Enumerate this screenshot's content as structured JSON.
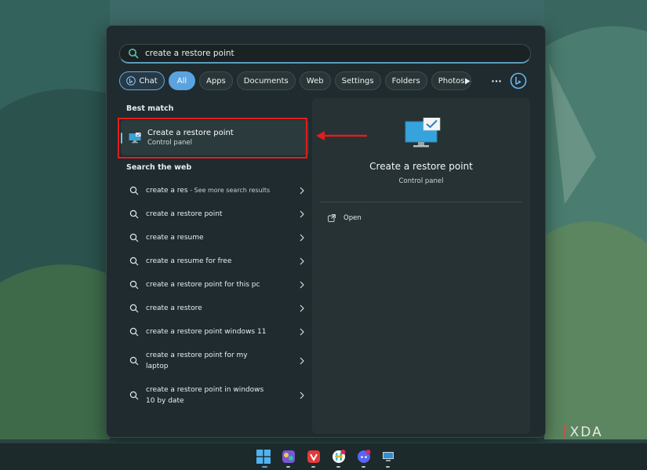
{
  "search": {
    "query": "create a restore point"
  },
  "filters": {
    "chat": "Chat",
    "all": "All",
    "apps": "Apps",
    "documents": "Documents",
    "web": "Web",
    "settings": "Settings",
    "folders": "Folders",
    "photos": "Photos"
  },
  "best_match": {
    "section_title": "Best match",
    "title": "Create a restore point",
    "subtitle": "Control panel"
  },
  "web": {
    "section_title": "Search the web",
    "items": [
      {
        "text": "create a res",
        "sub": " - See more search results"
      },
      {
        "text": "create a restore point"
      },
      {
        "text": "create a resume"
      },
      {
        "text": "create a resume for free"
      },
      {
        "text": "create a restore point for this pc"
      },
      {
        "text": "create a restore"
      },
      {
        "text": "create a restore point windows 11"
      },
      {
        "text": "create a restore point for my laptop"
      },
      {
        "text": "create a restore point in windows 10 by date"
      }
    ]
  },
  "preview": {
    "title": "Create a restore point",
    "subtitle": "Control panel",
    "open_label": "Open"
  },
  "watermark": {
    "left_bracket": "[",
    "right_bracket": "]",
    "text": "XDA"
  },
  "colors": {
    "accent": "#5aa3e0",
    "highlight_box": "#e41c1c",
    "panel": "#1f2b2e"
  },
  "icons": [
    "search-icon",
    "bing-icon",
    "play-icon",
    "more-icon",
    "chevron-right-icon",
    "open-external-icon",
    "monitor-check-icon",
    "windows-start-icon"
  ]
}
